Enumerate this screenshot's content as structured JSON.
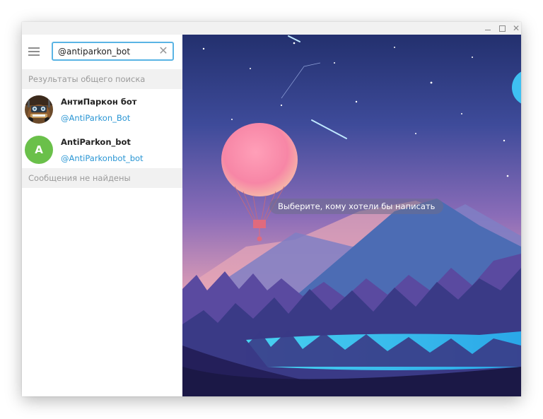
{
  "search": {
    "value": "@antiparkon_bot",
    "clear_icon": "✕"
  },
  "sidebar": {
    "global_results_header": "Результаты общего поиска",
    "results": [
      {
        "name": "АнтиПаркон бот",
        "handle": "@AntiParkon_Bot",
        "avatar": "tow-truck-cartoon-image"
      },
      {
        "name": "AntiParkon_bot",
        "handle": "@AntiParkonbot_bot",
        "avatar_letter": "A"
      }
    ],
    "no_messages": "Сообщения не найдены"
  },
  "chat": {
    "empty_hint": "Выберите, кому хотели бы написать"
  },
  "colors": {
    "accent": "#5ab4e4",
    "link": "#2a96d4",
    "avatar_green": "#6ac04a"
  }
}
